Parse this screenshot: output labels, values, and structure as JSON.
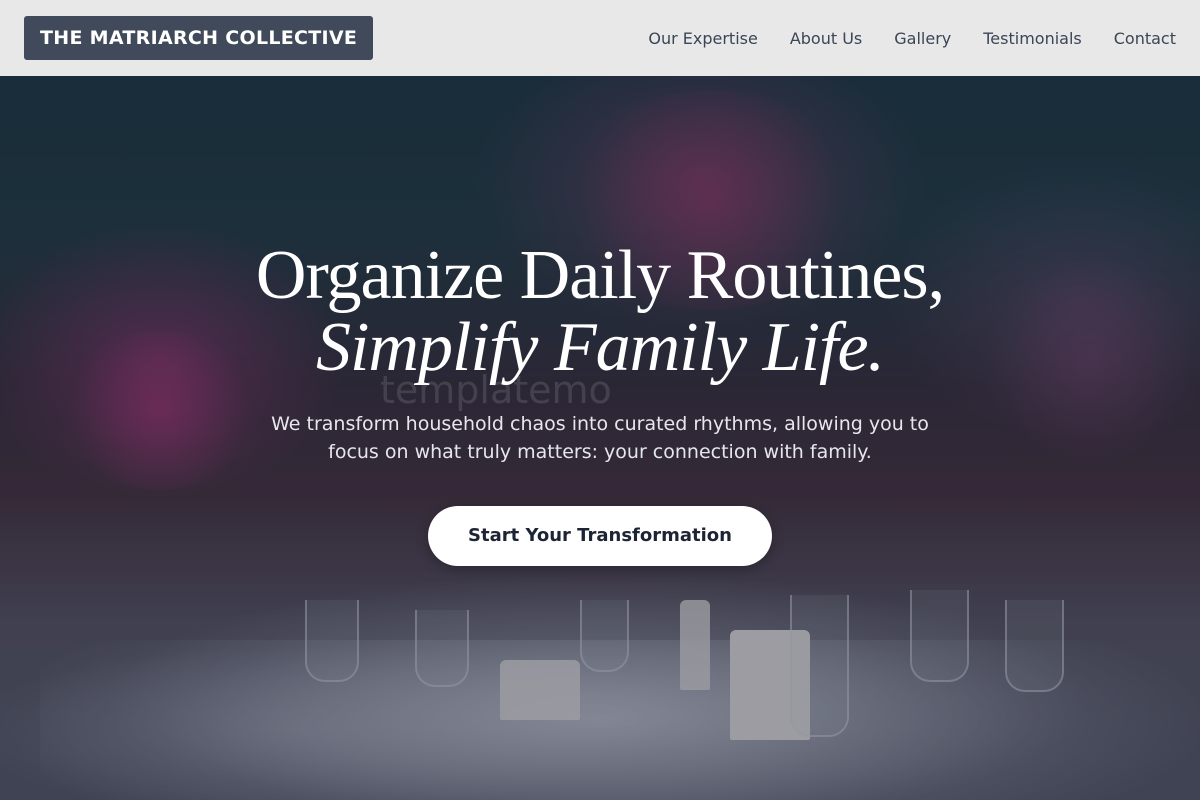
{
  "brand": {
    "name": "THE MATRIARCH COLLECTIVE"
  },
  "nav": {
    "links": [
      {
        "label": "Our Expertise"
      },
      {
        "label": "About Us"
      },
      {
        "label": "Gallery"
      },
      {
        "label": "Testimonials"
      },
      {
        "label": "Contact"
      }
    ]
  },
  "hero": {
    "headline_line1": "Organize Daily Routines,",
    "headline_line2": "Simplify Family Life.",
    "subtitle": "We transform household chaos into curated rhythms, allowing you to focus on what truly matters: your connection with family.",
    "cta_label": "Start Your Transformation",
    "watermark": "templatemo"
  },
  "colors": {
    "brand_bg": "#414a5a",
    "nav_bg": "#e8e8e9",
    "nav_text": "#3a4556",
    "cta_bg": "#ffffff",
    "cta_text": "#1d2433"
  }
}
